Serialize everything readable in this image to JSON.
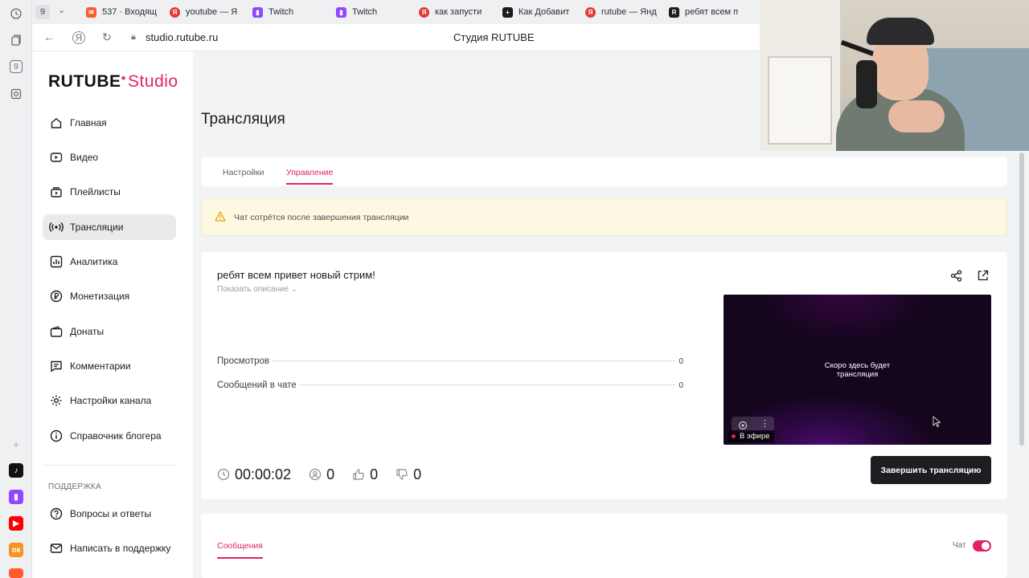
{
  "browser": {
    "tab_count": "9",
    "tabs": [
      {
        "label": "537 · Входящ",
        "color": "#ff5a2b"
      },
      {
        "label": "youtube — Я",
        "color": "#e53935"
      },
      {
        "label": "Twitch",
        "color": "#9146ff"
      },
      {
        "label": "Twitch",
        "color": "#9146ff"
      },
      {
        "label": "как запусти",
        "color": "#e53935"
      },
      {
        "label": "Как Добавит",
        "color": "#1b1c1e"
      },
      {
        "label": "rutube — Янд",
        "color": "#e53935"
      },
      {
        "label": "ребят всем п",
        "color": "#1b1c1e"
      }
    ],
    "url": "studio.rutube.ru",
    "page_title": "Студия RUTUBE",
    "rail_badges": [
      "9",
      "9"
    ]
  },
  "logo": {
    "brand": "RUTUBE",
    "product": "Studio"
  },
  "sidebar": {
    "items": [
      {
        "label": "Главная",
        "icon": "home-icon"
      },
      {
        "label": "Видео",
        "icon": "video-icon"
      },
      {
        "label": "Плейлисты",
        "icon": "playlist-icon"
      },
      {
        "label": "Трансляции",
        "icon": "broadcast-icon"
      },
      {
        "label": "Аналитика",
        "icon": "analytics-icon"
      },
      {
        "label": "Монетизация",
        "icon": "ruble-icon"
      },
      {
        "label": "Донаты",
        "icon": "wallet-icon"
      },
      {
        "label": "Комментарии",
        "icon": "comment-icon"
      },
      {
        "label": "Настройки канала",
        "icon": "gear-icon"
      },
      {
        "label": "Справочник блогера",
        "icon": "info-icon"
      }
    ],
    "support_heading": "ПОДДЕРЖКА",
    "support_items": [
      {
        "label": "Вопросы и ответы",
        "icon": "help-icon"
      },
      {
        "label": "Написать в поддержку",
        "icon": "mail-icon"
      }
    ]
  },
  "main": {
    "title": "Трансляция",
    "tabs": [
      {
        "label": "Настройки"
      },
      {
        "label": "Управление"
      }
    ],
    "warning": "Чат сотрётся после завершения трансляции",
    "stream": {
      "title": "ребят всем привет новый стрим!",
      "show_description": "Показать описание",
      "stats": [
        {
          "label": "Просмотров",
          "value": "0"
        },
        {
          "label": "Сообщений в чате",
          "value": "0"
        }
      ],
      "player_message_line1": "Скоро здесь будет",
      "player_message_line2": "трансляция",
      "live_badge": "В эфире",
      "timer": "00:00:02",
      "viewers": "0",
      "likes": "0",
      "dislikes": "0",
      "end_button": "Завершить трансляцию"
    },
    "chat": {
      "tab_label": "Сообщения",
      "toggle_label": "Чат"
    }
  },
  "colors": {
    "accent": "#e1245b",
    "warning_bg": "#fdf8e1"
  }
}
